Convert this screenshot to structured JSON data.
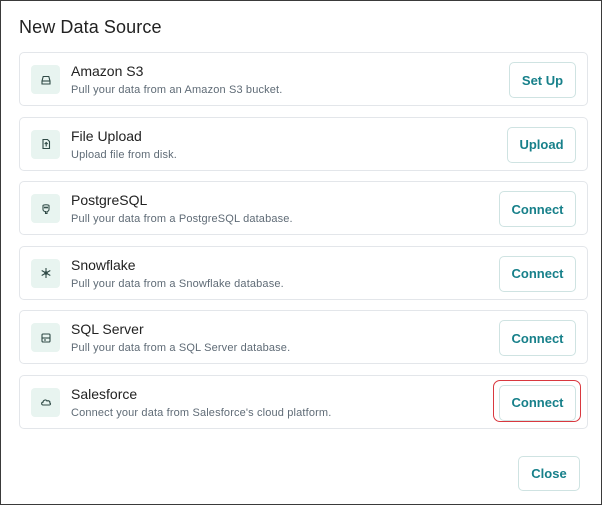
{
  "dialog": {
    "title": "New Data Source",
    "close_label": "Close"
  },
  "colors": {
    "accent": "#17808a",
    "icon_bg": "#e8f4f0",
    "highlight": "#d9383f"
  },
  "sources": [
    {
      "name": "Amazon S3",
      "description": "Pull your data from an Amazon S3 bucket.",
      "action": "Set Up",
      "icon": "drive-icon"
    },
    {
      "name": "File Upload",
      "description": "Upload file from disk.",
      "action": "Upload",
      "icon": "file-upload-icon"
    },
    {
      "name": "PostgreSQL",
      "description": "Pull your data from a PostgreSQL database.",
      "action": "Connect",
      "icon": "elephant-icon"
    },
    {
      "name": "Snowflake",
      "description": "Pull your data from a Snowflake database.",
      "action": "Connect",
      "icon": "snowflake-icon"
    },
    {
      "name": "SQL Server",
      "description": "Pull your data from a SQL Server database.",
      "action": "Connect",
      "icon": "server-icon"
    },
    {
      "name": "Salesforce",
      "description": "Connect your data from Salesforce's cloud platform.",
      "action": "Connect",
      "icon": "cloud-icon"
    }
  ]
}
